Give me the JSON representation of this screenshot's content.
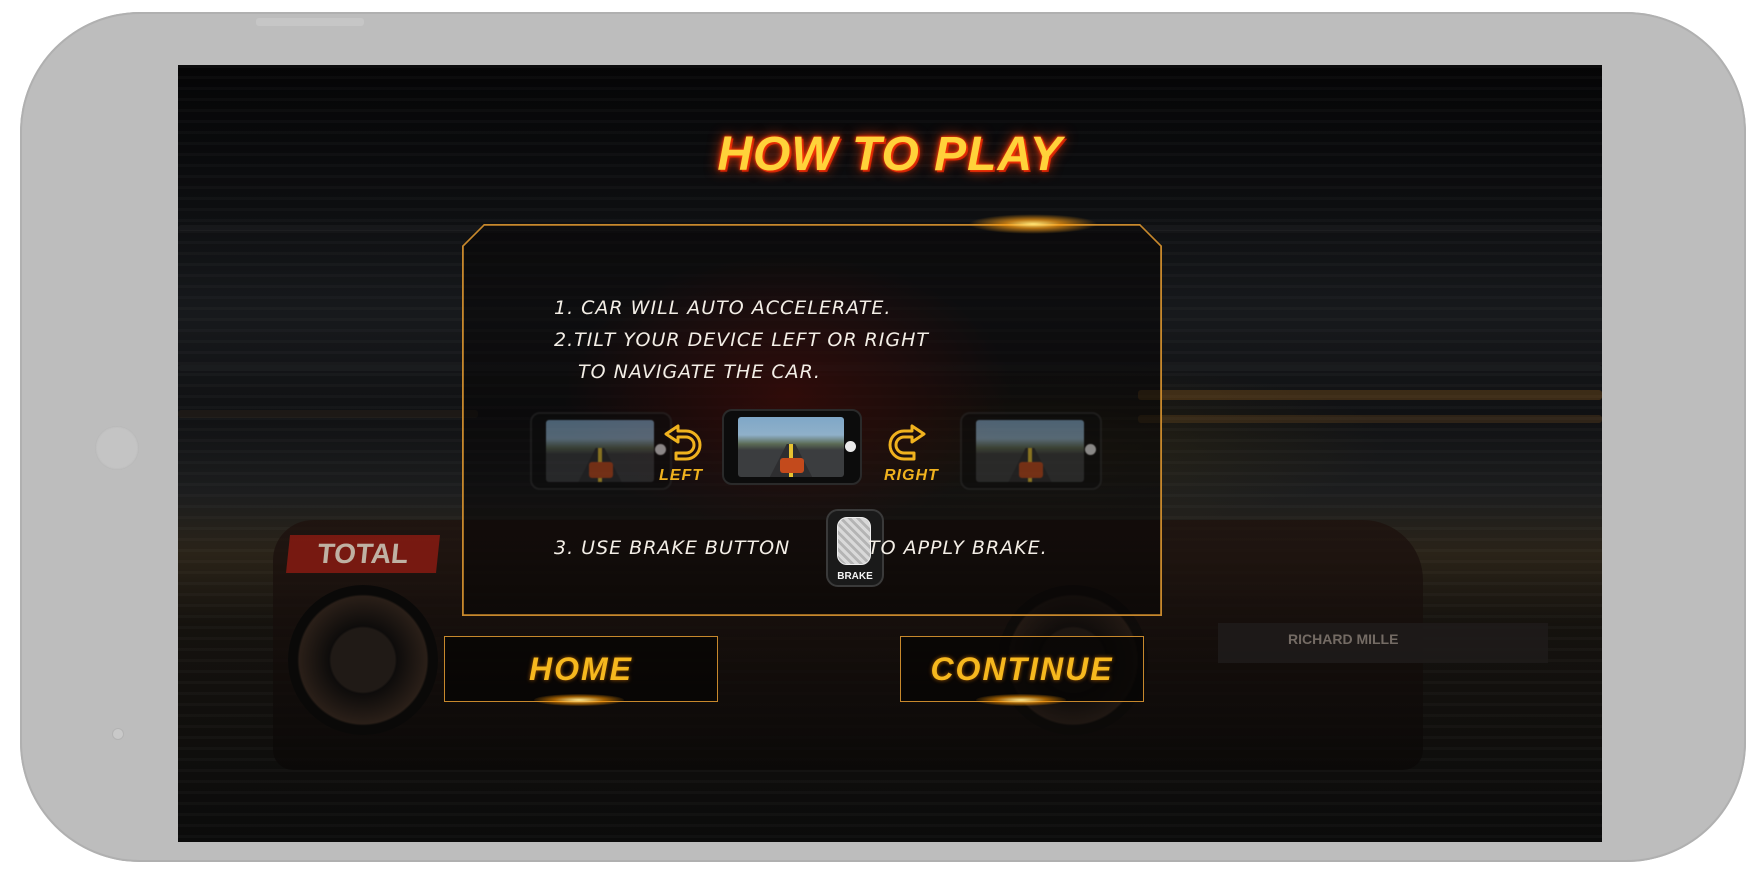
{
  "screen": {
    "title": "HOW TO PLAY"
  },
  "instructions": {
    "step1": "1. CAR WILL AUTO ACCELERATE.",
    "step2_line1": "2.TILT YOUR DEVICE LEFT OR RIGHT",
    "step2_line2": "TO NAVIGATE THE CAR.",
    "step3_before": "3. USE BRAKE BUTTON",
    "step3_after": "TO APPLY BRAKE.",
    "left_label": "LEFT",
    "right_label": "RIGHT",
    "brake_label": "BRAKE"
  },
  "background": {
    "car_sponsor": "TOTAL",
    "wing_sponsor": "RICHARD MILLE"
  },
  "buttons": {
    "home": "HOME",
    "continue": "CONTINUE"
  },
  "icons": {
    "left": "rotate-left-icon",
    "right": "rotate-right-icon",
    "brake": "brake-pedal-icon"
  },
  "colors": {
    "accent": "#f6b81e",
    "border": "#c7882c",
    "title_glow": "#ff3a0a"
  }
}
